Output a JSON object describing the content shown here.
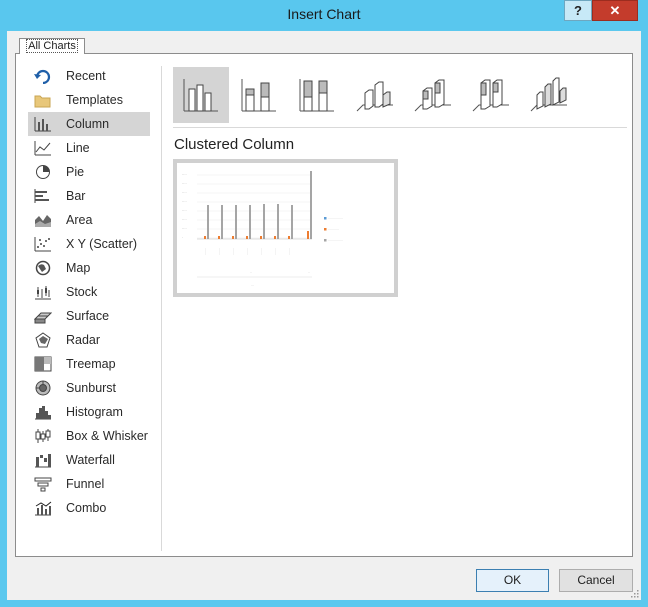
{
  "window": {
    "title": "Insert Chart",
    "help_label": "?",
    "close_label": "✕"
  },
  "tab": {
    "label": "All Charts"
  },
  "chart_types": [
    {
      "label": "Recent",
      "icon": "recent-icon"
    },
    {
      "label": "Templates",
      "icon": "folder-icon"
    },
    {
      "label": "Column",
      "icon": "column-chart-icon"
    },
    {
      "label": "Line",
      "icon": "line-chart-icon"
    },
    {
      "label": "Pie",
      "icon": "pie-chart-icon"
    },
    {
      "label": "Bar",
      "icon": "bar-chart-icon"
    },
    {
      "label": "Area",
      "icon": "area-chart-icon"
    },
    {
      "label": "X Y (Scatter)",
      "icon": "scatter-chart-icon"
    },
    {
      "label": "Map",
      "icon": "map-chart-icon"
    },
    {
      "label": "Stock",
      "icon": "stock-chart-icon"
    },
    {
      "label": "Surface",
      "icon": "surface-chart-icon"
    },
    {
      "label": "Radar",
      "icon": "radar-chart-icon"
    },
    {
      "label": "Treemap",
      "icon": "treemap-chart-icon"
    },
    {
      "label": "Sunburst",
      "icon": "sunburst-chart-icon"
    },
    {
      "label": "Histogram",
      "icon": "histogram-chart-icon"
    },
    {
      "label": "Box & Whisker",
      "icon": "box-whisker-chart-icon"
    },
    {
      "label": "Waterfall",
      "icon": "waterfall-chart-icon"
    },
    {
      "label": "Funnel",
      "icon": "funnel-chart-icon"
    },
    {
      "label": "Combo",
      "icon": "combo-chart-icon"
    }
  ],
  "selected_type": "Column",
  "subtypes": [
    "clustered-column-icon",
    "stacked-column-icon",
    "100-stacked-column-icon",
    "3d-clustered-column-icon",
    "3d-stacked-column-icon",
    "3d-100-stacked-column-icon",
    "3d-column-icon"
  ],
  "selected_subtype_title": "Clustered Column",
  "buttons": {
    "ok": "OK",
    "cancel": "Cancel"
  },
  "colors": {
    "accent": "#5bc8ee",
    "series_gray": "#a5a5a5",
    "series_orange": "#ed7d31",
    "series_blue": "#5b9bd5"
  }
}
